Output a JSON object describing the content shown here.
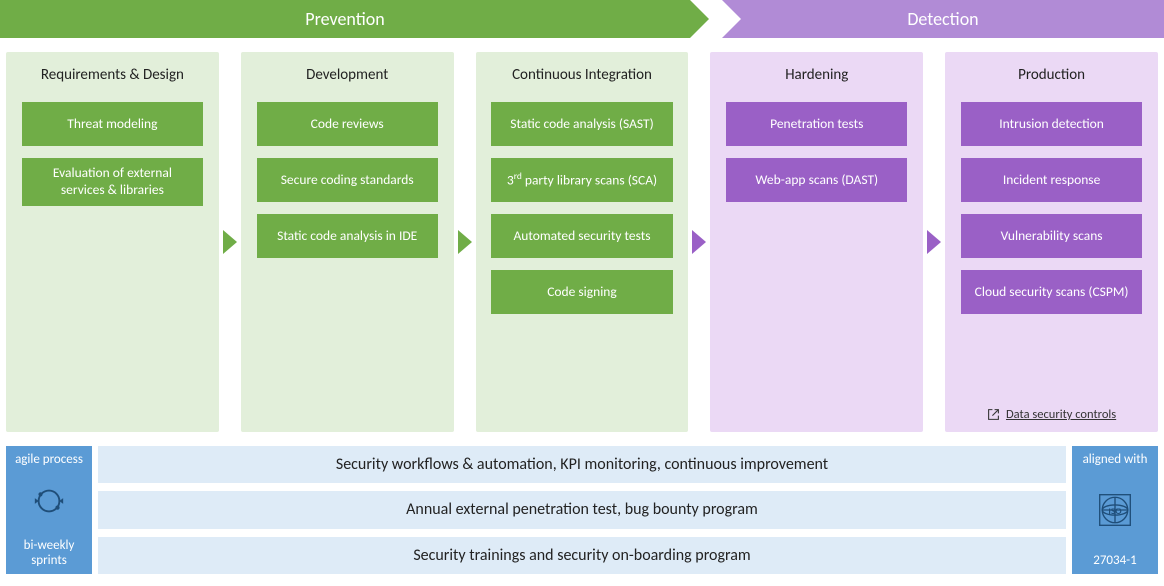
{
  "headers": {
    "prevention": "Prevention",
    "detection": "Detection"
  },
  "stages": [
    {
      "id": "requirements",
      "group": "prevention",
      "title": "Requirements & Design",
      "items": [
        "Threat modeling",
        "Evaluation of external services & libraries"
      ]
    },
    {
      "id": "development",
      "group": "prevention",
      "title": "Development",
      "items": [
        "Code reviews",
        "Secure coding standards",
        "Static code analysis in IDE"
      ]
    },
    {
      "id": "ci",
      "group": "prevention",
      "title": "Continuous Integration",
      "items": [
        "Static  code analysis (SAST)",
        "3rd party library scans (SCA)",
        "Automated security tests",
        "Code signing"
      ]
    },
    {
      "id": "hardening",
      "group": "detection",
      "title": "Hardening",
      "items": [
        "Penetration tests",
        "Web-app scans (DAST)"
      ]
    },
    {
      "id": "production",
      "group": "detection",
      "title": "Production",
      "items": [
        "Intrusion detection",
        "Incident response",
        "Vulnerability scans",
        "Cloud security scans (CSPM)"
      ],
      "link": "Data security controls"
    }
  ],
  "left_box": {
    "line1": "agile process",
    "line2": "bi-weekly sprints"
  },
  "right_box": {
    "line1": "aligned with",
    "line2": "27034-1",
    "iso_label": "ISO"
  },
  "bars": [
    "Security workflows & automation, KPI monitoring, continuous improvement",
    "Annual external penetration test, bug bounty program",
    "Security trainings and security on-boarding program"
  ],
  "sca_html": "3<sup>rd</sup> party library scans (SCA)"
}
